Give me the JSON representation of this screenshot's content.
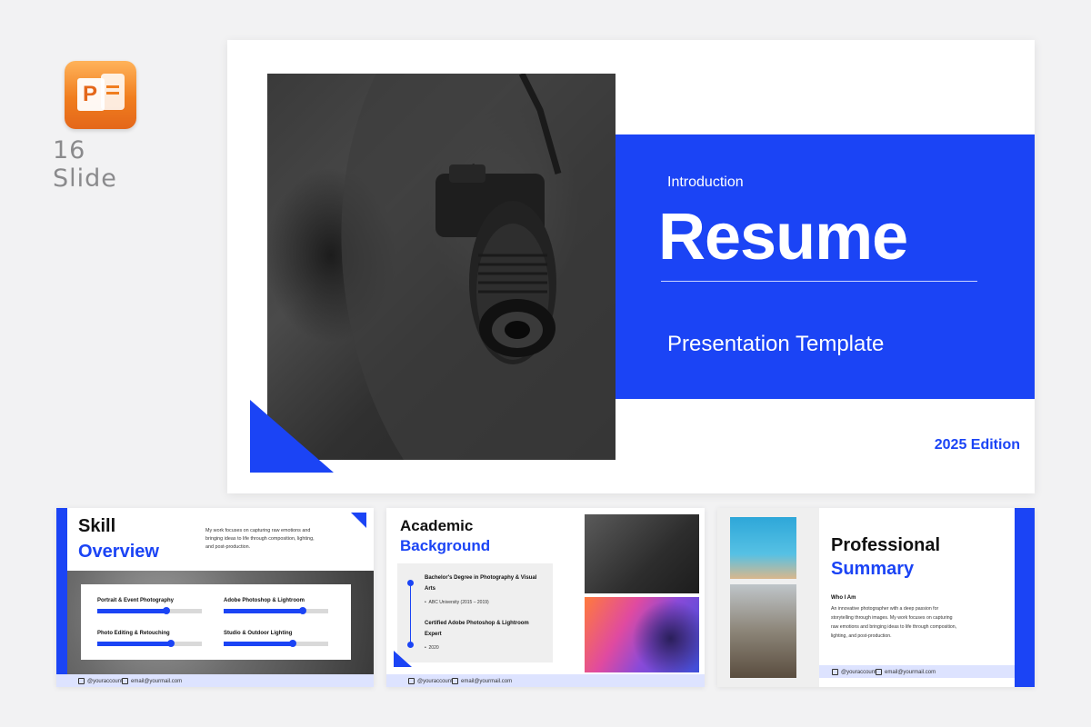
{
  "badge": {
    "app_icon": "powerpoint-icon",
    "app_letter": "P",
    "slide_count": "16 Slide"
  },
  "main_slide": {
    "intro": "Introduction",
    "title": "Resume",
    "subtitle": "Presentation Template",
    "edition": "2025 Edition"
  },
  "thumb_skill": {
    "title_line1": "Skill",
    "title_line2": "Overview",
    "description": "My work focuses on capturing raw emotions and bringing ideas to life through composition, lighting, and post-production.",
    "skills": [
      {
        "label": "Portrait & Event Photography",
        "level": 0.66
      },
      {
        "label": "Adobe Photoshop & Lightroom",
        "level": 0.76
      },
      {
        "label": "Photo Editing & Retouching",
        "level": 0.7
      },
      {
        "label": "Studio & Outdoor Lighting",
        "level": 0.66
      }
    ],
    "footer_account": "@youraccount",
    "footer_email": "email@yourmail.com"
  },
  "thumb_academic": {
    "title_line1": "Academic",
    "title_line2": "Background",
    "entries": [
      {
        "title": "Bachelor's Degree in Photography & Visual Arts",
        "detail": "ABC University (2015 – 2019)"
      },
      {
        "title": "Certified Adobe Photoshop & Lightroom Expert",
        "detail": "2020"
      }
    ],
    "footer_account": "@youraccount",
    "footer_email": "email@yourmail.com"
  },
  "thumb_summary": {
    "title_line1": "Professional",
    "title_line2": "Summary",
    "who_heading": "Who I Am",
    "description": "An innovative photographer with a deep passion for storytelling through images. My work focuses on capturing raw emotions and bringing ideas to life through composition, lighting, and post-production.",
    "footer_account": "@youraccount",
    "footer_email": "email@yourmail.com"
  },
  "colors": {
    "accent": "#1b44f5",
    "footer_tint": "#dde3ff"
  }
}
